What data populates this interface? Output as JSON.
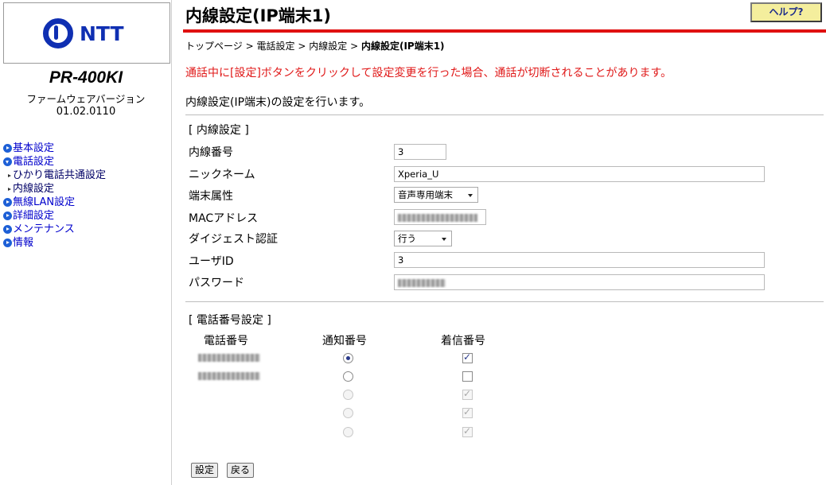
{
  "sidebar": {
    "logo_text": "NTT",
    "model": "PR-400KI",
    "firmware_label": "ファームウェアバージョン",
    "firmware_version": "01.02.0110",
    "nav": [
      {
        "label": "基本設定",
        "type": "top",
        "open": false
      },
      {
        "label": "電話設定",
        "type": "top",
        "open": true
      },
      {
        "label": "ひかり電話共通設定",
        "type": "sub"
      },
      {
        "label": "内線設定",
        "type": "sub"
      },
      {
        "label": "無線LAN設定",
        "type": "top",
        "open": false
      },
      {
        "label": "詳細設定",
        "type": "top",
        "open": false
      },
      {
        "label": "メンテナンス",
        "type": "top",
        "open": false
      },
      {
        "label": "情報",
        "type": "top",
        "open": false
      }
    ]
  },
  "header": {
    "title": "内線設定(IP端末1)",
    "help_label": "ヘルプ?",
    "accent_color": "#e01010"
  },
  "breadcrumb": {
    "items": [
      "トップページ",
      "電話設定",
      "内線設定"
    ],
    "separator": ">",
    "current": "内線設定(IP端末1)"
  },
  "warning": "通話中に[設定]ボタンをクリックして設定変更を行った場合、通話が切断されることがあります。",
  "description": "内線設定(IP端末)の設定を行います。",
  "extension": {
    "section_title": "[ 内線設定 ]",
    "fields": {
      "number": {
        "label": "内線番号",
        "value": "3"
      },
      "nickname": {
        "label": "ニックネーム",
        "value": "Xperia_U"
      },
      "terminal": {
        "label": "端末属性",
        "value": "音声専用端末"
      },
      "mac": {
        "label": "MACアドレス",
        "value": ""
      },
      "digest": {
        "label": "ダイジェスト認証",
        "value": "行う"
      },
      "userid": {
        "label": "ユーザID",
        "value": "3"
      },
      "password": {
        "label": "パスワード",
        "value": ""
      }
    }
  },
  "phone": {
    "section_title": "[ 電話番号設定 ]",
    "headers": {
      "number": "電話番号",
      "notify": "通知番号",
      "incoming": "着信番号"
    },
    "rows": [
      {
        "number_masked": true,
        "notify_checked": true,
        "notify_disabled": false,
        "incoming_checked": true,
        "incoming_disabled": false
      },
      {
        "number_masked": true,
        "notify_checked": false,
        "notify_disabled": false,
        "incoming_checked": false,
        "incoming_disabled": false
      },
      {
        "number_masked": false,
        "notify_checked": false,
        "notify_disabled": true,
        "incoming_checked": true,
        "incoming_disabled": true
      },
      {
        "number_masked": false,
        "notify_checked": false,
        "notify_disabled": true,
        "incoming_checked": true,
        "incoming_disabled": true
      },
      {
        "number_masked": false,
        "notify_checked": false,
        "notify_disabled": true,
        "incoming_checked": true,
        "incoming_disabled": true
      }
    ]
  },
  "buttons": {
    "save": "設定",
    "back": "戻る"
  }
}
